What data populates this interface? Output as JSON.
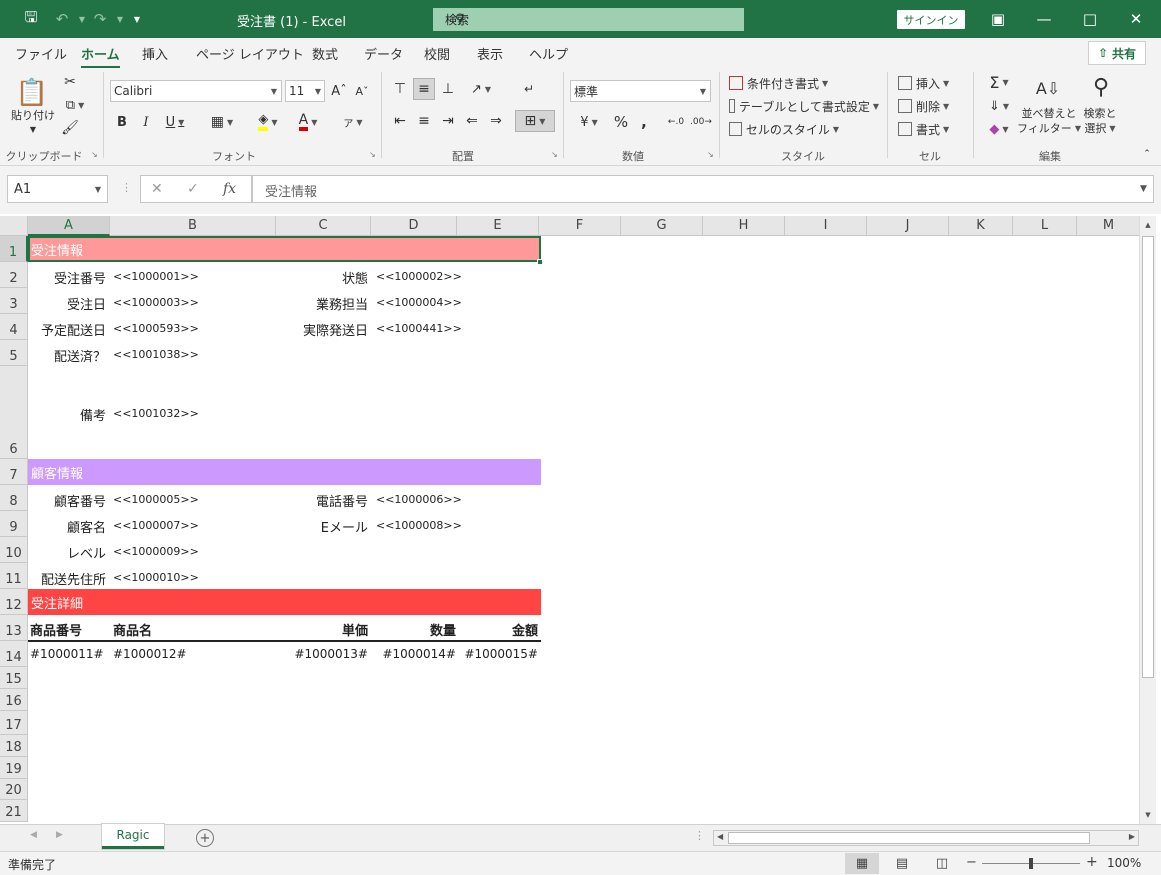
{
  "window": {
    "title": "受注書 (1)  -  Excel",
    "search_label": "検索",
    "signin_label": "サインイン"
  },
  "ribbon_tabs": [
    "ファイル",
    "ホーム",
    "挿入",
    "ページ レイアウト",
    "数式",
    "データ",
    "校閲",
    "表示",
    "ヘルプ"
  ],
  "active_tab": "ホーム",
  "share_label": "共有",
  "ribbon": {
    "clipboard": {
      "label": "クリップボード",
      "paste_label": "貼り付け"
    },
    "font": {
      "label": "フォント",
      "font_name": "Calibri",
      "font_size": "11"
    },
    "alignment": {
      "label": "配置"
    },
    "number": {
      "label": "数値",
      "format": "標準"
    },
    "styles": {
      "label": "スタイル",
      "conditional": "条件付き書式",
      "table": "テーブルとして書式設定",
      "cell_style": "セルのスタイル"
    },
    "cells": {
      "label": "セル",
      "insert": "挿入",
      "delete": "削除",
      "format": "書式"
    },
    "editing": {
      "label": "編集",
      "sort": "並べ替えと",
      "sort2": "フィルター",
      "find": "検索と",
      "find2": "選択"
    }
  },
  "formula_bar": {
    "name_box": "A1",
    "formula": "受注情報"
  },
  "columns": [
    "A",
    "B",
    "C",
    "D",
    "E",
    "F",
    "G",
    "H",
    "I",
    "J",
    "K",
    "L",
    "M"
  ],
  "rows": [
    "1",
    "2",
    "3",
    "4",
    "5",
    "6",
    "7",
    "8",
    "9",
    "10",
    "11",
    "12",
    "13",
    "14",
    "15",
    "16",
    "17",
    "18",
    "19",
    "20",
    "21"
  ],
  "sections": {
    "order": {
      "title": "受注情報",
      "color": "#ff9999"
    },
    "customer": {
      "title": "顧客情報",
      "color": "#cc99ff"
    },
    "detail": {
      "title": "受注詳細",
      "color": "#ff4444"
    }
  },
  "order_fields": {
    "order_no": {
      "label": "受注番号",
      "value": "<<1000001>>"
    },
    "status": {
      "label": "状態",
      "value": "<<1000002>>"
    },
    "order_date": {
      "label": "受注日",
      "value": "<<1000003>>"
    },
    "staff": {
      "label": "業務担当",
      "value": "<<1000004>>"
    },
    "planned_date": {
      "label": "予定配送日",
      "value": "<<1000593>>"
    },
    "actual_date": {
      "label": "実際発送日",
      "value": "<<1000441>>"
    },
    "shipped": {
      "label": "配送済？",
      "value": "<<1001038>>"
    },
    "memo": {
      "label": "備考",
      "value": "<<1001032>>"
    }
  },
  "customer_fields": {
    "cust_no": {
      "label": "顧客番号",
      "value": "<<1000005>>"
    },
    "phone": {
      "label": "電話番号",
      "value": "<<1000006>>"
    },
    "cust_name": {
      "label": "顧客名",
      "value": "<<1000007>>"
    },
    "email": {
      "label": "Eメール",
      "value": "<<1000008>>"
    },
    "level": {
      "label": "レベル",
      "value": "<<1000009>>"
    },
    "address": {
      "label": "配送先住所",
      "value": "<<1000010>>"
    }
  },
  "detail_table": {
    "headers": [
      "商品番号",
      "商品名",
      "単価",
      "数量",
      "金額"
    ],
    "row": [
      "#1000011#",
      "#1000012#",
      "#1000013#",
      "#1000014#",
      "#1000015#"
    ]
  },
  "sheet_tab": "Ragic",
  "status": {
    "text": "準備完了",
    "zoom": "100%",
    "zoom_level": 100
  }
}
